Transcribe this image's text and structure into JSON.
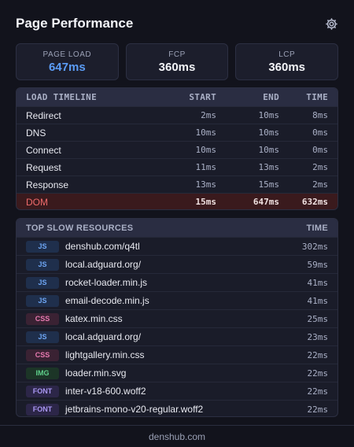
{
  "header": {
    "title": "Page Performance",
    "settings_icon": "gear-icon"
  },
  "metrics": [
    {
      "label": "PAGE LOAD",
      "value": "647ms",
      "accent": "#5b9cf5"
    },
    {
      "label": "FCP",
      "value": "360ms"
    },
    {
      "label": "LCP",
      "value": "360ms"
    }
  ],
  "timeline": {
    "columns": [
      "LOAD TIMELINE",
      "START",
      "END",
      "TIME"
    ],
    "rows": [
      {
        "name": "Redirect",
        "start": "2ms",
        "end": "10ms",
        "time": "8ms"
      },
      {
        "name": "DNS",
        "start": "10ms",
        "end": "10ms",
        "time": "0ms"
      },
      {
        "name": "Connect",
        "start": "10ms",
        "end": "10ms",
        "time": "0ms"
      },
      {
        "name": "Request",
        "start": "11ms",
        "end": "13ms",
        "time": "2ms"
      },
      {
        "name": "Response",
        "start": "13ms",
        "end": "15ms",
        "time": "2ms"
      },
      {
        "name": "DOM",
        "start": "15ms",
        "end": "647ms",
        "time": "632ms",
        "highlight": true
      }
    ]
  },
  "resources": {
    "columns": [
      "TOP SLOW RESOURCES",
      "TIME"
    ],
    "rows": [
      {
        "type": "JS",
        "name": "denshub.com/q4tl",
        "time": "302ms"
      },
      {
        "type": "JS",
        "name": "local.adguard.org/",
        "time": "59ms"
      },
      {
        "type": "JS",
        "name": "rocket-loader.min.js",
        "time": "41ms"
      },
      {
        "type": "JS",
        "name": "email-decode.min.js",
        "time": "41ms"
      },
      {
        "type": "CSS",
        "name": "katex.min.css",
        "time": "25ms"
      },
      {
        "type": "JS",
        "name": "local.adguard.org/",
        "time": "23ms"
      },
      {
        "type": "CSS",
        "name": "lightgallery.min.css",
        "time": "22ms"
      },
      {
        "type": "IMG",
        "name": "loader.min.svg",
        "time": "22ms"
      },
      {
        "type": "FONT",
        "name": "inter-v18-600.woff2",
        "time": "22ms"
      },
      {
        "type": "FONT",
        "name": "jetbrains-mono-v20-regular.woff2",
        "time": "22ms"
      }
    ]
  },
  "footer": {
    "domain": "denshub.com"
  }
}
